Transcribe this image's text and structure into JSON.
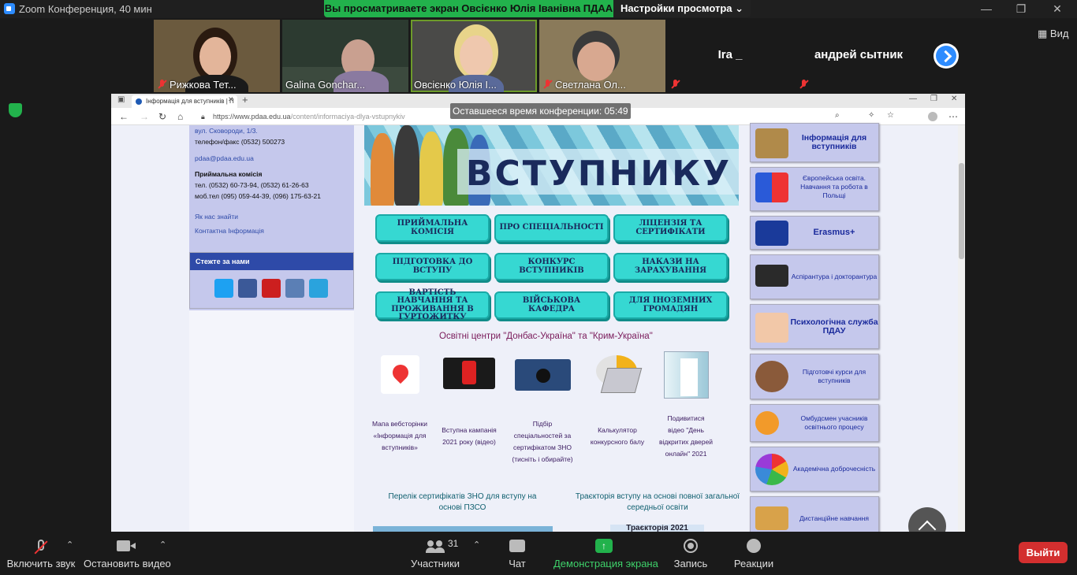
{
  "window": {
    "title": "Zoom Конференция, 40 мин"
  },
  "share_banner": {
    "message": "Вы просматриваете экран Овсієнко Юлія Іванівна ПДАА",
    "view_settings": "Настройки просмотра"
  },
  "participants_strip": [
    {
      "name": "Рижкова Тет...",
      "muted": true
    },
    {
      "name": "Galina Gonchar...",
      "muted": false
    },
    {
      "name": "Овсієнко Юлія І...",
      "muted": false
    },
    {
      "name": "Светлана Ол...",
      "muted": true
    },
    {
      "name": "Ira _",
      "muted": true
    },
    {
      "name": "андрей сытник",
      "muted": true
    }
  ],
  "view_button": "Вид",
  "time_left": "Оставшееся время конференции: 05:49",
  "browser": {
    "tab_title": "Інформація для вступників | П",
    "url_host": "https://www.pdaa.edu.ua",
    "url_path": "/content/informaciya-dlya-vstupnykiv"
  },
  "page": {
    "contacts": {
      "street": "вул. Сковороди, 1/3.",
      "phone_fax": "телефон/факс (0532) 500273",
      "email": "pdaa@pdaa.edu.ua",
      "commission_title": "Приймальна комісія",
      "phones": "тел. (0532) 60-73-94, (0532) 61-26-63",
      "mobile": "моб.тел (095) 059-44-39, (096) 175-63-21",
      "find_us": "Як нас знайти",
      "contact_info": "Контактна Інформація"
    },
    "follow_title": "Стежте за нами",
    "social": [
      {
        "icon": "twitter-icon",
        "color": "#1da1f2"
      },
      {
        "icon": "facebook-icon",
        "color": "#3b5998"
      },
      {
        "icon": "youtube-icon",
        "color": "#cc1f1f"
      },
      {
        "icon": "instagram-icon",
        "color": "#5b7fb5"
      },
      {
        "icon": "telegram-icon",
        "color": "#2aa3dd"
      }
    ],
    "banner_title": "ВСТУПНИКУ",
    "buttons": [
      "ПРИЙМАЛЬНА КОМІСІЯ",
      "ПРО СПЕЦІАЛЬНОСТІ",
      "ЛІЦЕНЗІЯ ТА СЕРТИФІКАТИ",
      "ПІДГОТОВКА ДО ВСТУПУ",
      "КОНКУРС ВСТУПНИКІВ",
      "НАКАЗИ НА ЗАРАХУВАННЯ",
      "ВАРТІСТЬ НАВЧАННЯ ТА ПРОЖИВАННЯ В ГУРТОЖИТКУ",
      "ВІЙСЬКОВА КАФЕДРА",
      "ДЛЯ ІНОЗЕМНИХ ГРОМАДЯН"
    ],
    "centers_link": "Освітні центри \"Донбас-Україна\" та \"Крим-Україна\"",
    "tiles": [
      {
        "icon": "map-pin-icon",
        "caption": "Мапа вебсторінки «Інформація для вступників»"
      },
      {
        "icon": "phone-video-icon",
        "caption": "Вступна кампанія 2021 року (відео)"
      },
      {
        "icon": "graduate-icon",
        "caption": "Підбір спеціальностей за сертифікатом ЗНО (тисніть і обирайте)"
      },
      {
        "icon": "calculator-icon",
        "caption": "Калькулятор конкурсного балу"
      },
      {
        "icon": "open-door-icon",
        "caption": "Подивитися відео \"День відкритих дверей онлайн\" 2021"
      }
    ],
    "bottom_links": [
      "Перелік сертифікатів ЗНО для вступу на основі ПЗСО",
      "Траєкторія вступу на основі повної загальної середньої освіти"
    ],
    "trajectory_badge": "Траєкторія 2021",
    "right_cards": [
      "Інформація для вступників",
      "Європейська освіта. Навчання та робота в Польщі",
      "Erasmus+",
      "Аспірантура і докторантура",
      "Психологічна служба ПДАУ",
      "Підготовчі курси для вступників",
      "Омбудсмен учасників освітнього процесу",
      "Академічна доброчесність",
      "Дистанційне навчання"
    ]
  },
  "toolbar": {
    "unmute": "Включить звук",
    "stop_video": "Остановить видео",
    "participants": "Участники",
    "participants_count": "31",
    "chat": "Чат",
    "share_screen": "Демонстрация экрана",
    "record": "Запись",
    "reactions": "Реакции",
    "leave": "Выйти"
  },
  "colors": {
    "zoom_blue": "#2d8cff",
    "share_green": "#22b24c",
    "leave_red": "#d32f2f",
    "button_teal": "#36d8d2",
    "site_blue": "#2e4aa8"
  }
}
